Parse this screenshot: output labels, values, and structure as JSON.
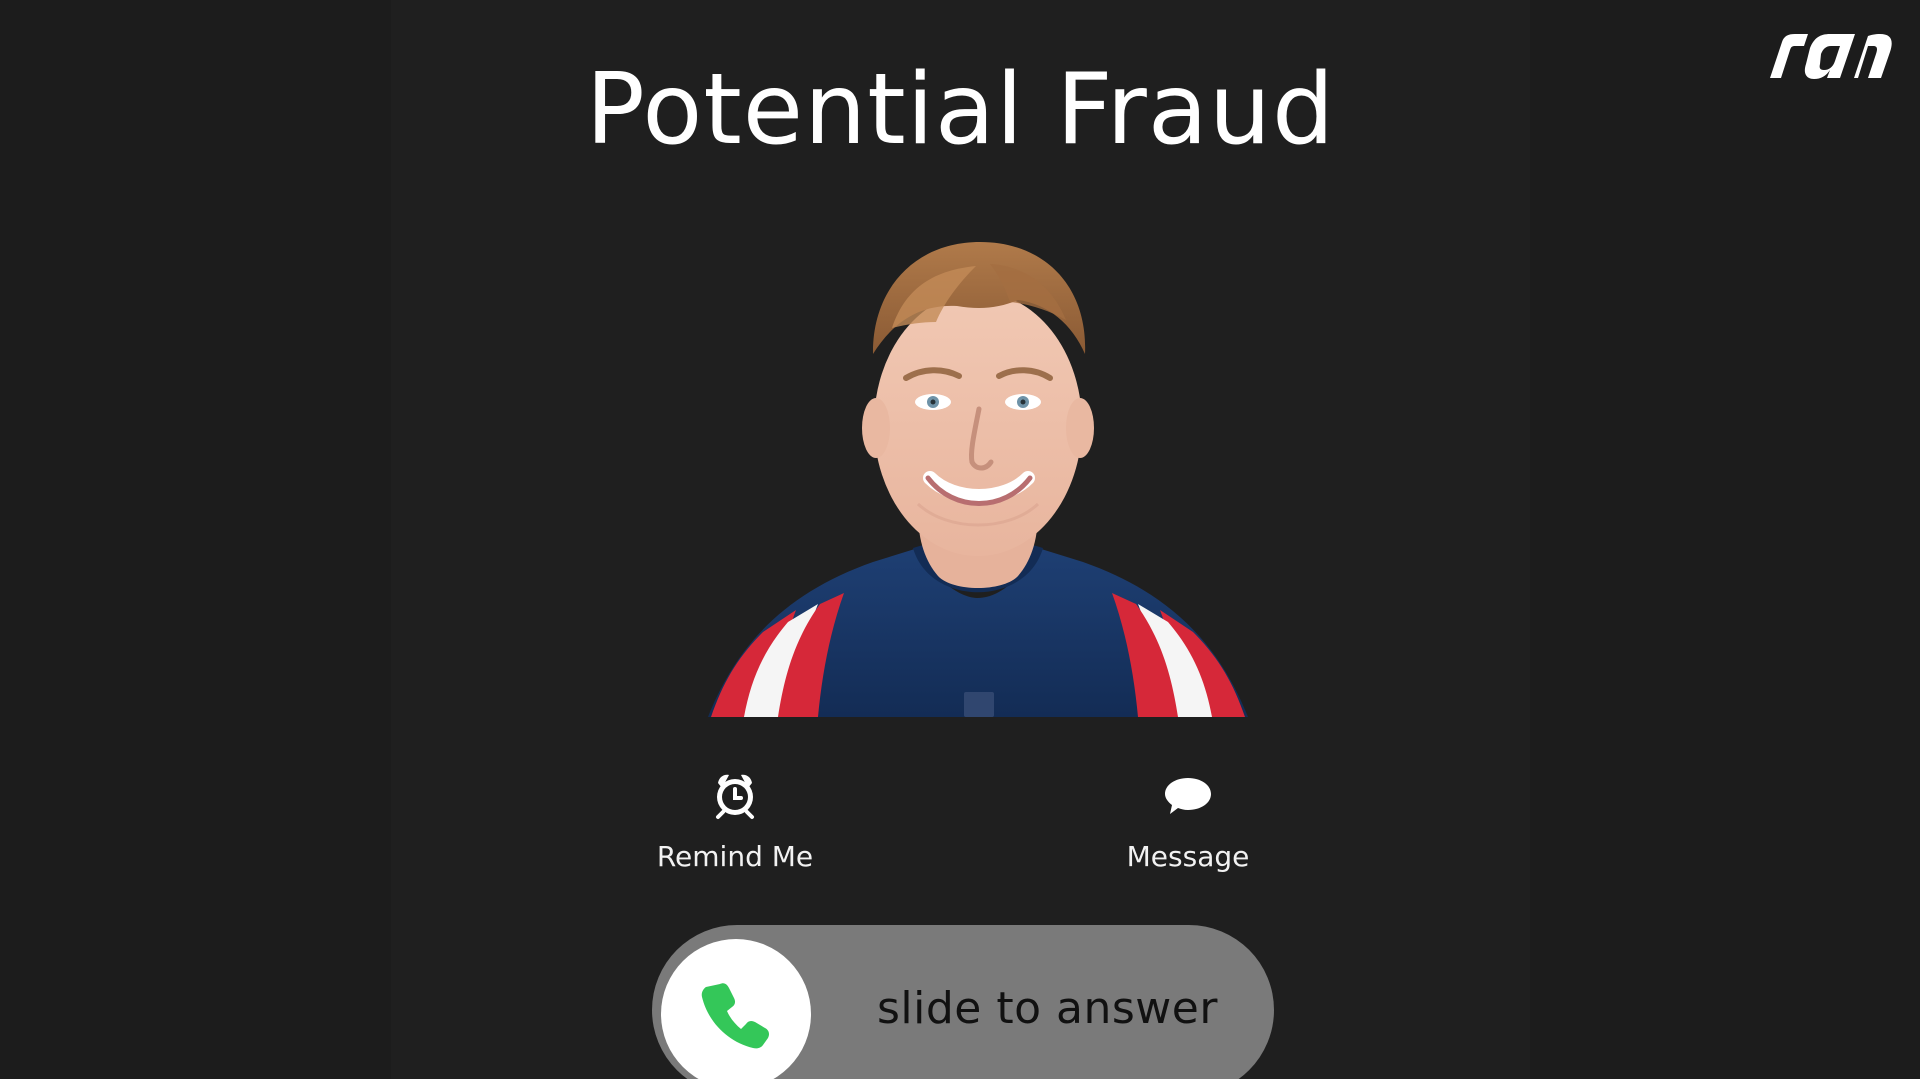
{
  "branding": {
    "logo_text": "ran",
    "logo_icon": "ran-logo-icon"
  },
  "call": {
    "title": "Potential Fraud",
    "caller_photo": "avatar"
  },
  "actions": {
    "remind": {
      "label": "Remind Me",
      "icon": "alarm-clock-icon"
    },
    "message": {
      "label": "Message",
      "icon": "speech-bubble-icon"
    }
  },
  "answer": {
    "slider_text": "slide to answer",
    "icon": "phone-icon",
    "accent": "#34c759"
  },
  "colors": {
    "background": "#1c1c1c",
    "panel": "#1f1f1f",
    "text": "#ffffff",
    "slider_track": "#7a7a7a"
  }
}
